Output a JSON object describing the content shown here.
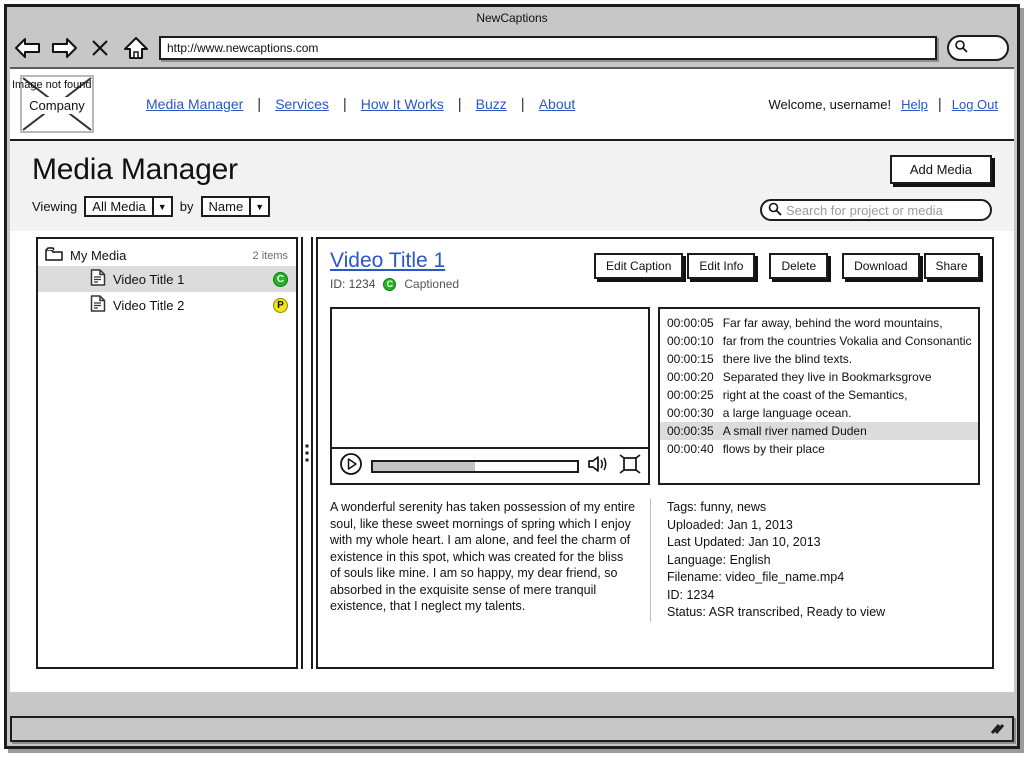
{
  "browser": {
    "window_title": "NewCaptions",
    "url": "http://www.newcaptions.com",
    "icons": {
      "back": "back-arrow-icon",
      "forward": "forward-arrow-icon",
      "stop": "stop-x-icon",
      "home": "home-icon",
      "search": "search-icon"
    }
  },
  "site_header": {
    "logo_label": "Company",
    "broken_image_text": "Image not found",
    "nav_items": [
      {
        "label": "Media Manager"
      },
      {
        "label": "Services"
      },
      {
        "label": "How It Works"
      },
      {
        "label": "Buzz"
      },
      {
        "label": "About"
      }
    ],
    "nav_separator": "|",
    "welcome_text": "Welcome, username!",
    "help_label": "Help",
    "logout_label": "Log Out"
  },
  "title_band": {
    "page_title": "Media Manager",
    "viewing_label": "Viewing",
    "by_label": "by",
    "filter_value": "All Media",
    "sort_value": "Name",
    "dropdown_arrow": "▼",
    "add_media_label": "Add Media",
    "search_placeholder": "Search for project or media"
  },
  "sidebar": {
    "root_label": "My Media",
    "root_count": "2 items",
    "folder_icon": "folder-icon",
    "items": [
      {
        "label": "Video Title 1",
        "badge": "C",
        "badge_color": "green",
        "selected": true
      },
      {
        "label": "Video Title 2",
        "badge": "P",
        "badge_color": "yellow",
        "selected": false
      }
    ]
  },
  "detail": {
    "title": "Video Title 1",
    "id_label": "ID: 1234",
    "status_badge": "C",
    "status_label": "Captioned",
    "actions": [
      {
        "label": "Edit Caption"
      },
      {
        "label": "Edit Info"
      },
      {
        "label": "Delete"
      },
      {
        "label": "Download"
      },
      {
        "label": "Share"
      }
    ],
    "player": {
      "play_icon": "play-icon",
      "volume_icon": "volume-icon",
      "fullscreen_icon": "fullscreen-icon",
      "progress_percent": 50
    },
    "transcript": [
      {
        "time": "00:00:05",
        "text": "Far far away, behind the word mountains,",
        "active": false
      },
      {
        "time": "00:00:10",
        "text": "far from the countries Vokalia and Consonantic",
        "active": false
      },
      {
        "time": "00:00:15",
        "text": "there live the blind texts.",
        "active": false
      },
      {
        "time": "00:00:20",
        "text": "Separated they live in Bookmarksgrove",
        "active": false
      },
      {
        "time": "00:00:25",
        "text": "right at the coast of the Semantics,",
        "active": false
      },
      {
        "time": "00:00:30",
        "text": "a large language ocean.",
        "active": false
      },
      {
        "time": "00:00:35",
        "text": "A small river named Duden",
        "active": true
      },
      {
        "time": "00:00:40",
        "text": "flows by their place",
        "active": false
      }
    ],
    "description": "A wonderful serenity has taken possession of my entire soul, like these sweet mornings of spring which I enjoy with my whole heart. I am alone, and feel the charm of existence in this spot, which was created for the bliss of souls like mine. I am so happy, my dear friend, so absorbed in the exquisite sense of mere tranquil existence, that I neglect my talents.",
    "metadata": [
      {
        "key": "Tags:",
        "value": "funny, news"
      },
      {
        "key": "Uploaded:",
        "value": "Jan 1, 2013"
      },
      {
        "key": "Last Updated:",
        "value": "Jan 10, 2013"
      },
      {
        "key": "Language:",
        "value": "English"
      },
      {
        "key": "Filename:",
        "value": "video_file_name.mp4"
      },
      {
        "key": "ID:",
        "value": "1234"
      },
      {
        "key": "Status:",
        "value": "ASR transcribed, Ready to view"
      }
    ]
  },
  "colors": {
    "link": "#2a56c6",
    "captioned_badge": "#22b522",
    "processing_badge": "#f2e312",
    "selection": "#dcdcdc",
    "chrome": "#c7c7c7"
  }
}
